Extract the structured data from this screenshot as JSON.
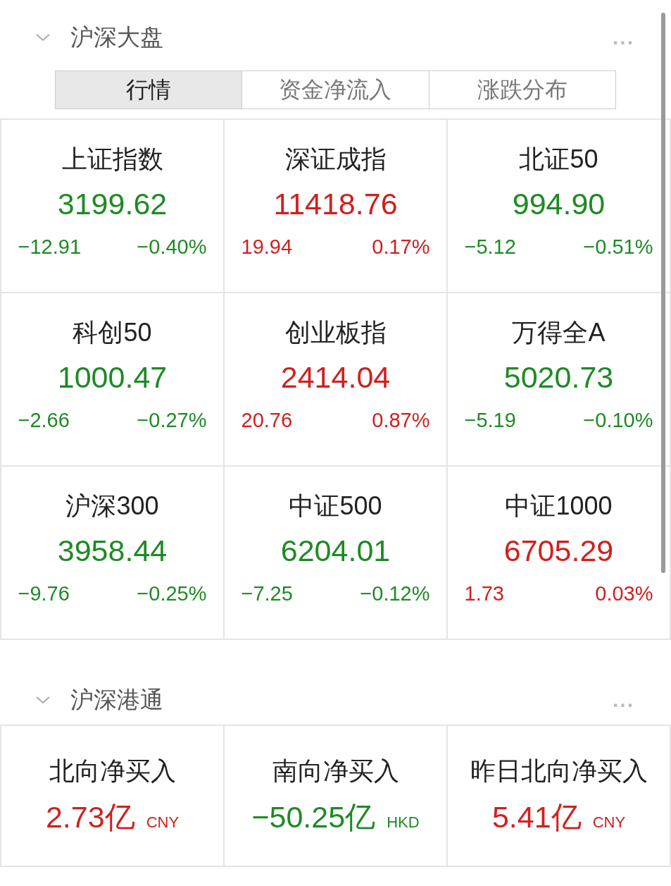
{
  "sections": [
    {
      "title": "沪深大盘",
      "more": "...",
      "expanded": true,
      "tabs": [
        {
          "label": "行情",
          "selected": true
        },
        {
          "label": "资金净流入",
          "selected": false
        },
        {
          "label": "涨跌分布",
          "selected": false
        }
      ],
      "indices": [
        {
          "name": "上证指数",
          "value": "3199.62",
          "change": "−12.91",
          "pct": "−0.40%",
          "color": "#1e8a25"
        },
        {
          "name": "深证成指",
          "value": "11418.76",
          "change": "19.94",
          "pct": "0.17%",
          "color": "#d0201f"
        },
        {
          "name": "北证50",
          "value": "994.90",
          "change": "−5.12",
          "pct": "−0.51%",
          "color": "#1e8a25"
        },
        {
          "name": "科创50",
          "value": "1000.47",
          "change": "−2.66",
          "pct": "−0.27%",
          "color": "#1e8a25"
        },
        {
          "name": "创业板指",
          "value": "2414.04",
          "change": "20.76",
          "pct": "0.87%",
          "color": "#d0201f"
        },
        {
          "name": "万得全A",
          "value": "5020.73",
          "change": "−5.19",
          "pct": "−0.10%",
          "color": "#1e8a25"
        },
        {
          "name": "沪深300",
          "value": "3958.44",
          "change": "−9.76",
          "pct": "−0.25%",
          "color": "#1e8a25"
        },
        {
          "name": "中证500",
          "value": "6204.01",
          "change": "−7.25",
          "pct": "−0.12%",
          "color": "#1e8a25"
        },
        {
          "name": "中证1000",
          "value": "6705.29",
          "change": "1.73",
          "pct": "0.03%",
          "color": "#d0201f"
        }
      ]
    },
    {
      "title": "沪深港通",
      "more": "...",
      "expanded": true,
      "flows": [
        {
          "name": "北向净买入",
          "value": "2.73亿",
          "unit": "CNY",
          "color": "#d0201f"
        },
        {
          "name": "南向净买入",
          "value": "−50.25亿",
          "unit": "HKD",
          "color": "#1e8a25"
        },
        {
          "name": "昨日北向净买入",
          "value": "5.41亿",
          "unit": "CNY",
          "color": "#d0201f"
        }
      ]
    }
  ]
}
